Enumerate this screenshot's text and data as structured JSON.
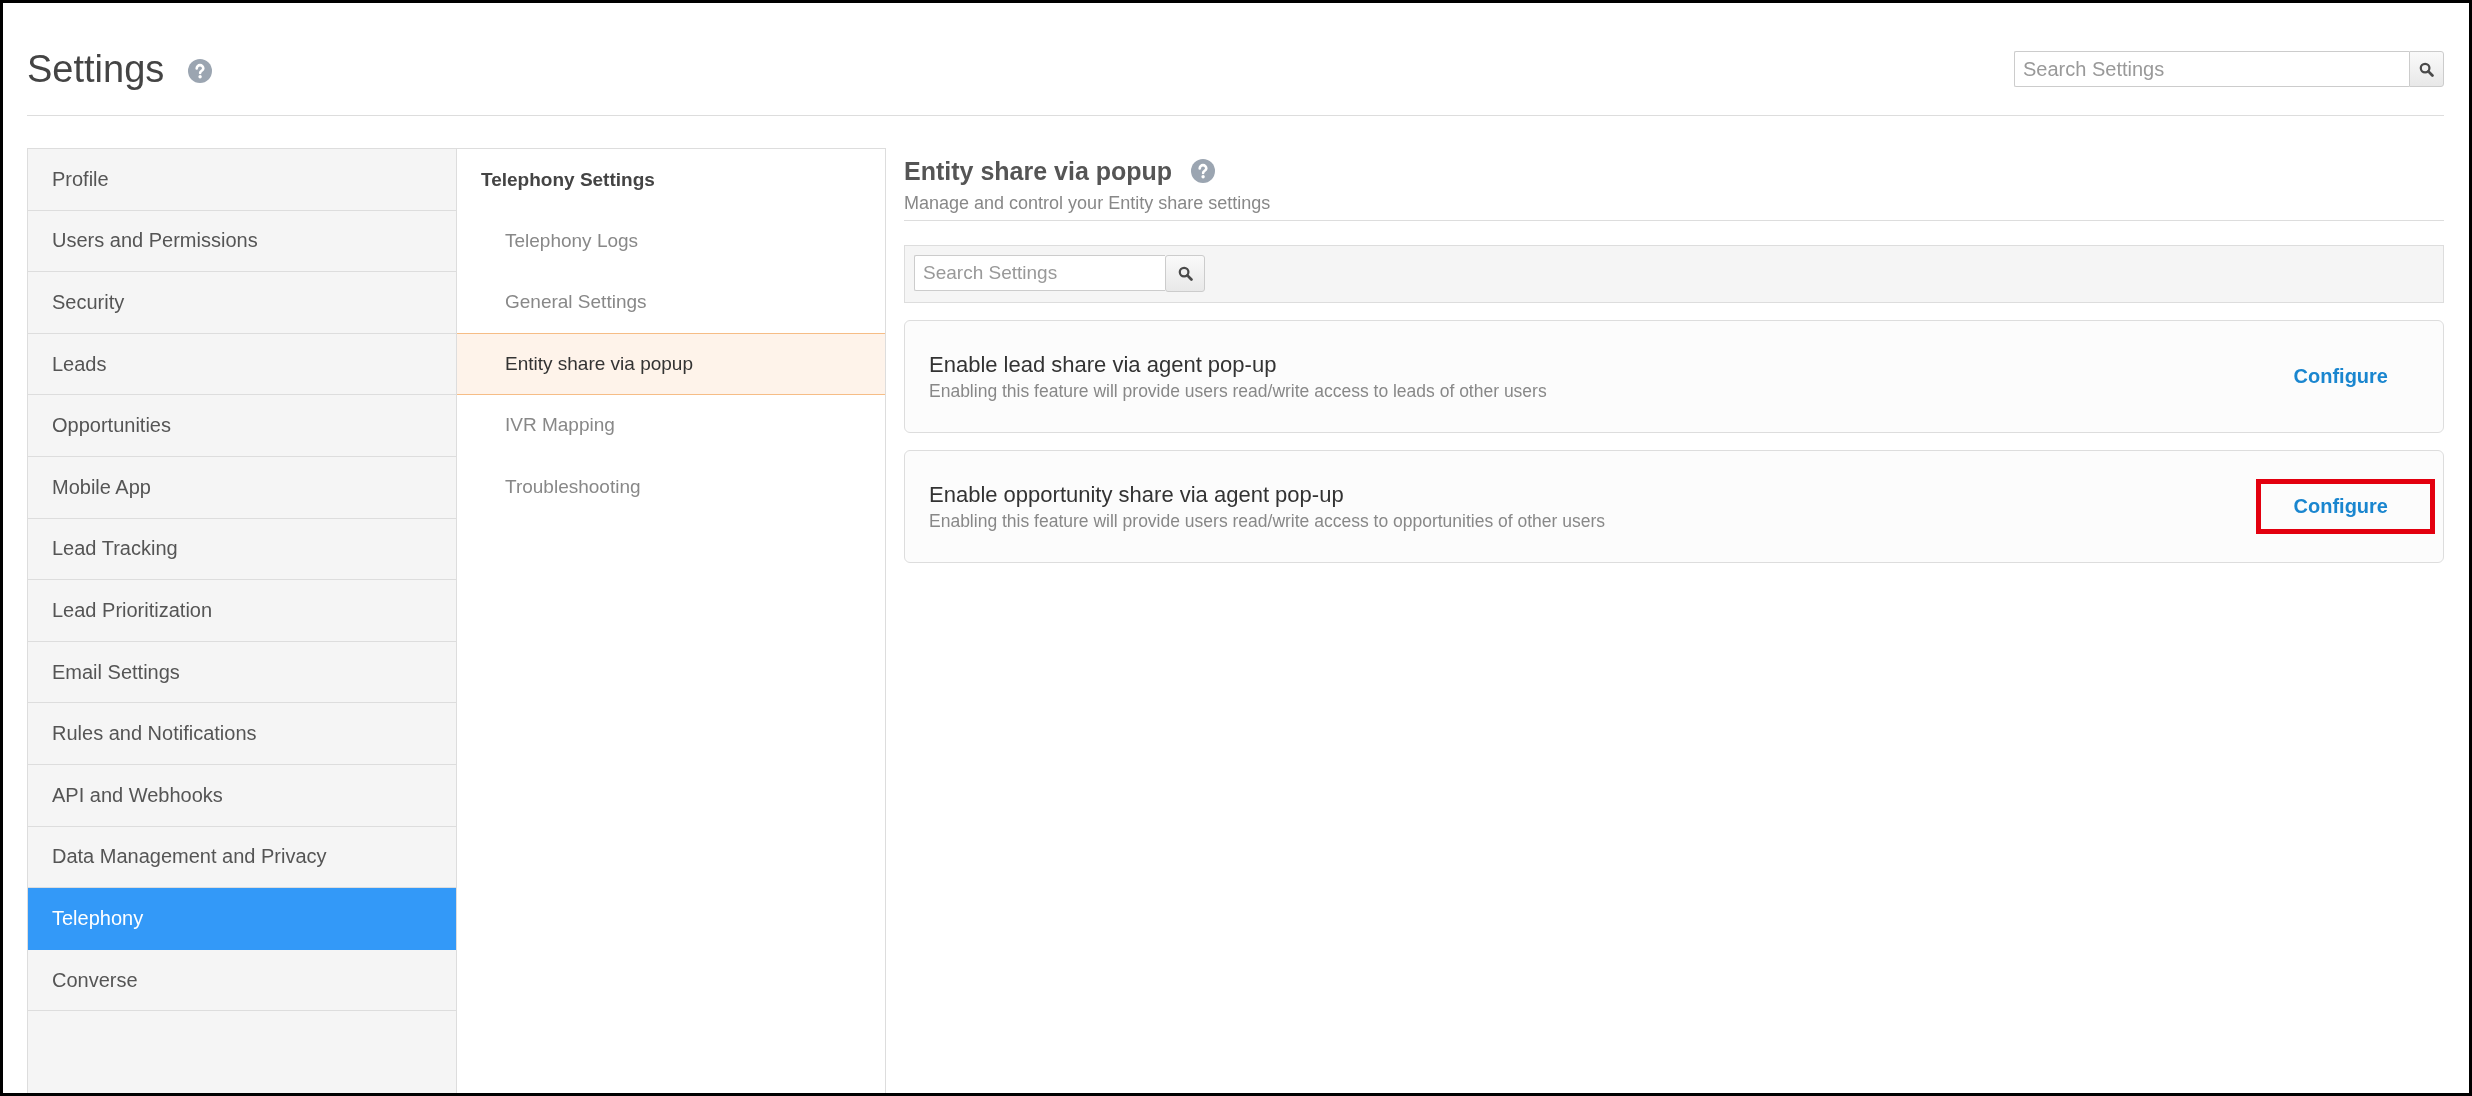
{
  "header": {
    "title": "Settings",
    "search": {
      "placeholder": "Search Settings"
    }
  },
  "sidebar": {
    "items": [
      {
        "label": "Profile",
        "selected": false
      },
      {
        "label": "Users and Permissions",
        "selected": false
      },
      {
        "label": "Security",
        "selected": false
      },
      {
        "label": "Leads",
        "selected": false
      },
      {
        "label": "Opportunities",
        "selected": false
      },
      {
        "label": "Mobile App",
        "selected": false
      },
      {
        "label": "Lead Tracking",
        "selected": false
      },
      {
        "label": "Lead Prioritization",
        "selected": false
      },
      {
        "label": "Email Settings",
        "selected": false
      },
      {
        "label": "Rules and Notifications",
        "selected": false
      },
      {
        "label": "API and Webhooks",
        "selected": false
      },
      {
        "label": "Data Management and Privacy",
        "selected": false
      },
      {
        "label": "Telephony",
        "selected": true
      },
      {
        "label": "Converse",
        "selected": false
      }
    ]
  },
  "subnav": {
    "heading": "Telephony Settings",
    "items": [
      {
        "label": "Telephony Logs",
        "selected": false
      },
      {
        "label": "General Settings",
        "selected": false
      },
      {
        "label": "Entity share via popup",
        "selected": true
      },
      {
        "label": "IVR Mapping",
        "selected": false
      },
      {
        "label": "Troubleshooting",
        "selected": false
      }
    ]
  },
  "content": {
    "title": "Entity share via popup",
    "subtitle": "Manage and control your Entity share settings",
    "search": {
      "placeholder": "Search Settings"
    },
    "cards": [
      {
        "title": "Enable lead share via agent pop-up",
        "description": "Enabling this feature will provide users read/write access to leads of other users",
        "action": "Configure",
        "highlighted": false
      },
      {
        "title": "Enable opportunity share via agent pop-up",
        "description": "Enabling this feature will provide users read/write access to opportunities of other users",
        "action": "Configure",
        "highlighted": true
      }
    ]
  }
}
